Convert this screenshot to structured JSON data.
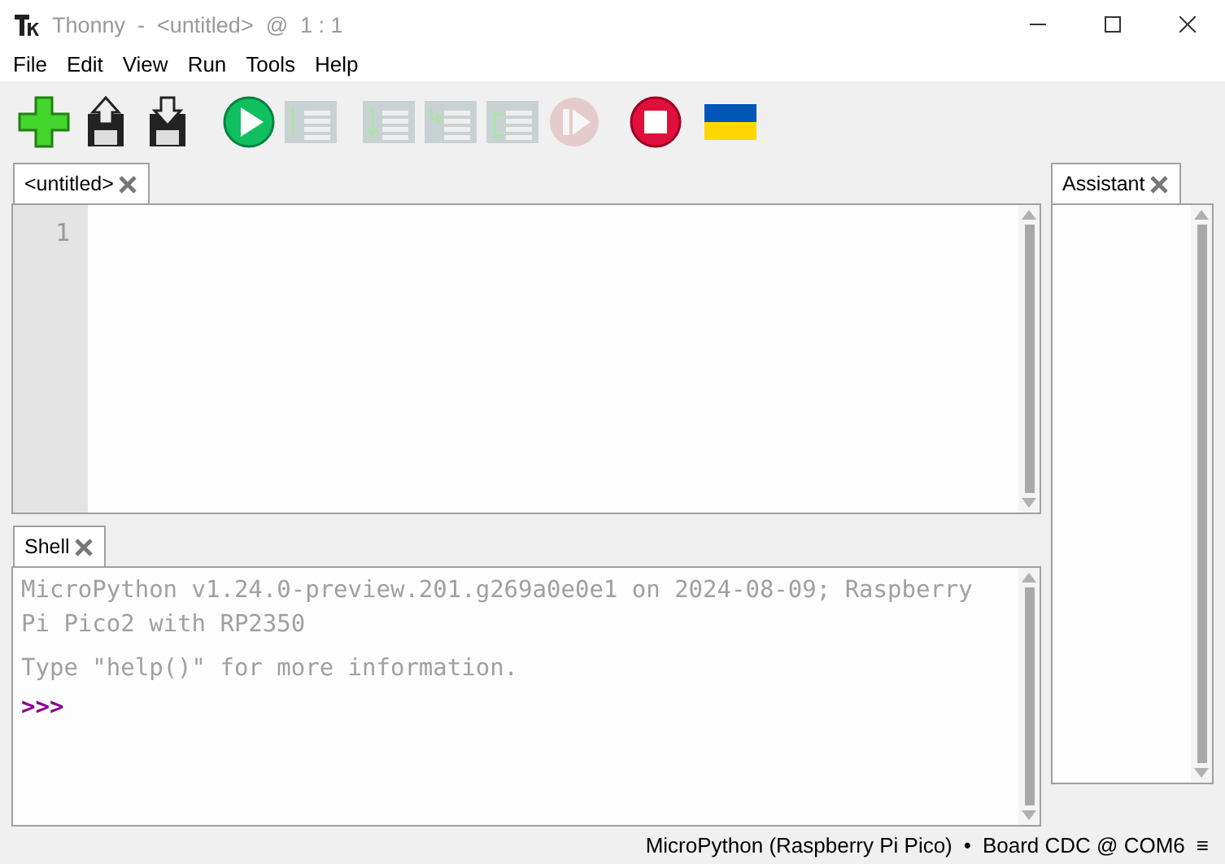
{
  "window": {
    "title": "Thonny  -  <untitled>  @  1 : 1"
  },
  "menu": [
    "File",
    "Edit",
    "View",
    "Run",
    "Tools",
    "Help"
  ],
  "toolbar": [
    {
      "kind": "new",
      "disabled": false
    },
    {
      "kind": "load",
      "disabled": false
    },
    {
      "kind": "save",
      "disabled": false
    },
    {
      "kind": "run",
      "disabled": false
    },
    {
      "kind": "debug",
      "disabled": true
    },
    {
      "kind": "step_over",
      "disabled": true
    },
    {
      "kind": "step_into",
      "disabled": true
    },
    {
      "kind": "step_out",
      "disabled": true
    },
    {
      "kind": "resume",
      "disabled": true
    },
    {
      "kind": "stop",
      "disabled": false
    },
    {
      "kind": "flag",
      "disabled": false
    }
  ],
  "editor": {
    "tabs": [
      {
        "label": "<untitled>",
        "selected": true
      }
    ],
    "line_numbers": [
      "1"
    ]
  },
  "shell": {
    "tabs": [
      {
        "label": "Shell",
        "selected": true
      }
    ],
    "lines": [
      {
        "kind": "banner",
        "text": "MicroPython v1.24.0-preview.201.g269a0e0e1 on 2024-08-09; Raspberry Pi Pico2 with RP2350"
      },
      {
        "kind": "banner",
        "text": "Type \"help()\" for more information."
      },
      {
        "kind": "prompt",
        "text": ">>>"
      }
    ]
  },
  "assistant": {
    "tabs": [
      {
        "label": "Assistant",
        "selected": true
      }
    ]
  },
  "status_bar": {
    "interpreter": "MicroPython (Raspberry Pi Pico)",
    "separator": "•",
    "port": "Board CDC @ COM6",
    "menu_glyph": "≡"
  }
}
